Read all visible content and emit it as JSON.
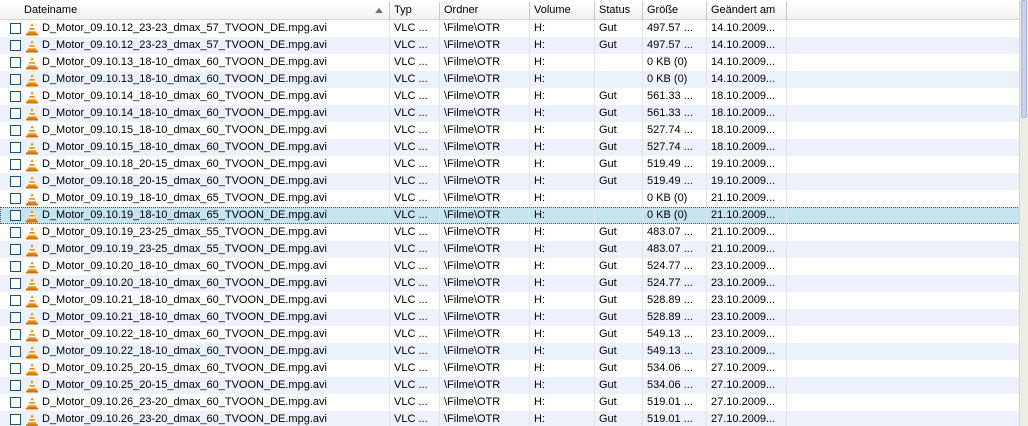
{
  "columns": {
    "name": "Dateiname",
    "typ": "Typ",
    "ordner": "Ordner",
    "volume": "Volume",
    "status": "Status",
    "groesse": "Größe",
    "geaendert": "Geändert am"
  },
  "icons": {
    "file": "vlc-cone-icon",
    "sort": "sort-ascending-icon"
  },
  "colors": {
    "alt_row": "#edf1fb",
    "selected_row": "#c6e3f0",
    "checkbox_border": "#1c5180",
    "cone_orange": "#f08a00"
  },
  "selected_index": 11,
  "rows": [
    {
      "name": "D_Motor_09.10.12_23-23_dmax_57_TVOON_DE.mpg.avi",
      "typ": "VLC ...",
      "ordner": "\\Filme\\OTR",
      "volume": "H:",
      "status": "Gut",
      "groesse": "497.57 ...",
      "geaendert": "14.10.2009..."
    },
    {
      "name": "D_Motor_09.10.12_23-23_dmax_57_TVOON_DE.mpg.avi",
      "typ": "VLC ...",
      "ordner": "\\Filme\\OTR",
      "volume": "H:",
      "status": "Gut",
      "groesse": "497.57 ...",
      "geaendert": "14.10.2009..."
    },
    {
      "name": "D_Motor_09.10.13_18-10_dmax_60_TVOON_DE.mpg.avi",
      "typ": "VLC ...",
      "ordner": "\\Filme\\OTR",
      "volume": "H:",
      "status": "",
      "groesse": "0 KB (0)",
      "geaendert": "14.10.2009..."
    },
    {
      "name": "D_Motor_09.10.13_18-10_dmax_60_TVOON_DE.mpg.avi",
      "typ": "VLC ...",
      "ordner": "\\Filme\\OTR",
      "volume": "H:",
      "status": "",
      "groesse": "0 KB (0)",
      "geaendert": "14.10.2009..."
    },
    {
      "name": "D_Motor_09.10.14_18-10_dmax_60_TVOON_DE.mpg.avi",
      "typ": "VLC ...",
      "ordner": "\\Filme\\OTR",
      "volume": "H:",
      "status": "Gut",
      "groesse": "561.33 ...",
      "geaendert": "18.10.2009..."
    },
    {
      "name": "D_Motor_09.10.14_18-10_dmax_60_TVOON_DE.mpg.avi",
      "typ": "VLC ...",
      "ordner": "\\Filme\\OTR",
      "volume": "H:",
      "status": "Gut",
      "groesse": "561.33 ...",
      "geaendert": "18.10.2009..."
    },
    {
      "name": "D_Motor_09.10.15_18-10_dmax_60_TVOON_DE.mpg.avi",
      "typ": "VLC ...",
      "ordner": "\\Filme\\OTR",
      "volume": "H:",
      "status": "Gut",
      "groesse": "527.74 ...",
      "geaendert": "18.10.2009..."
    },
    {
      "name": "D_Motor_09.10.15_18-10_dmax_60_TVOON_DE.mpg.avi",
      "typ": "VLC ...",
      "ordner": "\\Filme\\OTR",
      "volume": "H:",
      "status": "Gut",
      "groesse": "527.74 ...",
      "geaendert": "18.10.2009..."
    },
    {
      "name": "D_Motor_09.10.18_20-15_dmax_60_TVOON_DE.mpg.avi",
      "typ": "VLC ...",
      "ordner": "\\Filme\\OTR",
      "volume": "H:",
      "status": "Gut",
      "groesse": "519.49 ...",
      "geaendert": "19.10.2009..."
    },
    {
      "name": "D_Motor_09.10.18_20-15_dmax_60_TVOON_DE.mpg.avi",
      "typ": "VLC ...",
      "ordner": "\\Filme\\OTR",
      "volume": "H:",
      "status": "Gut",
      "groesse": "519.49 ...",
      "geaendert": "19.10.2009..."
    },
    {
      "name": "D_Motor_09.10.19_18-10_dmax_65_TVOON_DE.mpg.avi",
      "typ": "VLC ...",
      "ordner": "\\Filme\\OTR",
      "volume": "H:",
      "status": "",
      "groesse": "0 KB (0)",
      "geaendert": "21.10.2009..."
    },
    {
      "name": "D_Motor_09.10.19_18-10_dmax_65_TVOON_DE.mpg.avi",
      "typ": "VLC ...",
      "ordner": "\\Filme\\OTR",
      "volume": "H:",
      "status": "",
      "groesse": "0 KB (0)",
      "geaendert": "21.10.2009..."
    },
    {
      "name": "D_Motor_09.10.19_23-25_dmax_55_TVOON_DE.mpg.avi",
      "typ": "VLC ...",
      "ordner": "\\Filme\\OTR",
      "volume": "H:",
      "status": "Gut",
      "groesse": "483.07 ...",
      "geaendert": "21.10.2009..."
    },
    {
      "name": "D_Motor_09.10.19_23-25_dmax_55_TVOON_DE.mpg.avi",
      "typ": "VLC ...",
      "ordner": "\\Filme\\OTR",
      "volume": "H:",
      "status": "Gut",
      "groesse": "483.07 ...",
      "geaendert": "21.10.2009..."
    },
    {
      "name": "D_Motor_09.10.20_18-10_dmax_60_TVOON_DE.mpg.avi",
      "typ": "VLC ...",
      "ordner": "\\Filme\\OTR",
      "volume": "H:",
      "status": "Gut",
      "groesse": "524.77 ...",
      "geaendert": "23.10.2009..."
    },
    {
      "name": "D_Motor_09.10.20_18-10_dmax_60_TVOON_DE.mpg.avi",
      "typ": "VLC ...",
      "ordner": "\\Filme\\OTR",
      "volume": "H:",
      "status": "Gut",
      "groesse": "524.77 ...",
      "geaendert": "23.10.2009..."
    },
    {
      "name": "D_Motor_09.10.21_18-10_dmax_60_TVOON_DE.mpg.avi",
      "typ": "VLC ...",
      "ordner": "\\Filme\\OTR",
      "volume": "H:",
      "status": "Gut",
      "groesse": "528.89 ...",
      "geaendert": "23.10.2009..."
    },
    {
      "name": "D_Motor_09.10.21_18-10_dmax_60_TVOON_DE.mpg.avi",
      "typ": "VLC ...",
      "ordner": "\\Filme\\OTR",
      "volume": "H:",
      "status": "Gut",
      "groesse": "528.89 ...",
      "geaendert": "23.10.2009..."
    },
    {
      "name": "D_Motor_09.10.22_18-10_dmax_60_TVOON_DE.mpg.avi",
      "typ": "VLC ...",
      "ordner": "\\Filme\\OTR",
      "volume": "H:",
      "status": "Gut",
      "groesse": "549.13 ...",
      "geaendert": "23.10.2009..."
    },
    {
      "name": "D_Motor_09.10.22_18-10_dmax_60_TVOON_DE.mpg.avi",
      "typ": "VLC ...",
      "ordner": "\\Filme\\OTR",
      "volume": "H:",
      "status": "Gut",
      "groesse": "549.13 ...",
      "geaendert": "23.10.2009..."
    },
    {
      "name": "D_Motor_09.10.25_20-15_dmax_60_TVOON_DE.mpg.avi",
      "typ": "VLC ...",
      "ordner": "\\Filme\\OTR",
      "volume": "H:",
      "status": "Gut",
      "groesse": "534.06 ...",
      "geaendert": "27.10.2009..."
    },
    {
      "name": "D_Motor_09.10.25_20-15_dmax_60_TVOON_DE.mpg.avi",
      "typ": "VLC ...",
      "ordner": "\\Filme\\OTR",
      "volume": "H:",
      "status": "Gut",
      "groesse": "534.06 ...",
      "geaendert": "27.10.2009..."
    },
    {
      "name": "D_Motor_09.10.26_23-20_dmax_60_TVOON_DE.mpg.avi",
      "typ": "VLC ...",
      "ordner": "\\Filme\\OTR",
      "volume": "H:",
      "status": "Gut",
      "groesse": "519.01 ...",
      "geaendert": "27.10.2009..."
    },
    {
      "name": "D_Motor_09.10.26_23-20_dmax_60_TVOON_DE.mpg.avi",
      "typ": "VLC ...",
      "ordner": "\\Filme\\OTR",
      "volume": "H:",
      "status": "Gut",
      "groesse": "519.01 ...",
      "geaendert": "27.10.2009..."
    }
  ]
}
